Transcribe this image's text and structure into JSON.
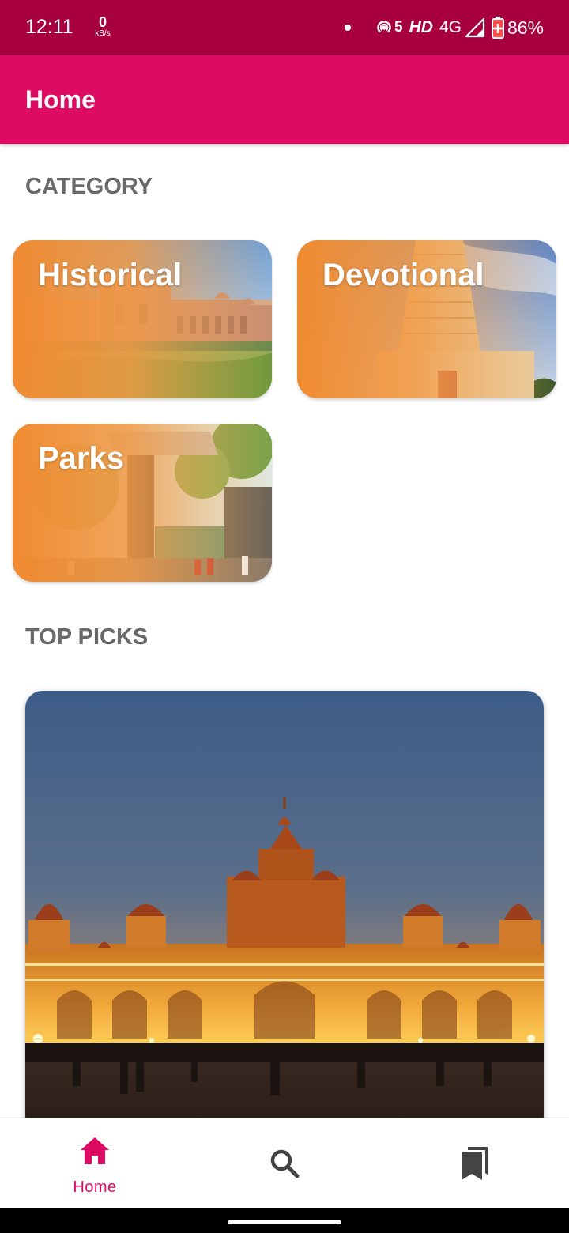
{
  "status_bar": {
    "time": "12:11",
    "net_speed_value": "0",
    "net_speed_unit": "kB/s",
    "hotspot_label": "5",
    "hd_label": "HD",
    "network_label": "4G",
    "battery_percent": "86%",
    "background_color": "#a8003f"
  },
  "app_bar": {
    "title": "Home",
    "color": "#dd0b62"
  },
  "sections": {
    "category_title": "CATEGORY",
    "top_picks_title": "TOP PICKS"
  },
  "categories": [
    {
      "label": "Historical",
      "image": "palace-photo"
    },
    {
      "label": "Devotional",
      "image": "temple-tower-photo"
    },
    {
      "label": "Parks",
      "image": "park-entrance-photo"
    }
  ],
  "top_picks": [
    {
      "image": "illuminated-palace-night-photo"
    }
  ],
  "bottom_nav": {
    "items": [
      {
        "label": "Home",
        "icon": "home-icon",
        "selected": true
      },
      {
        "label": "",
        "icon": "search-icon",
        "selected": false
      },
      {
        "label": "",
        "icon": "bookmarks-icon",
        "selected": false
      }
    ],
    "active_color": "#dd0b62",
    "inactive_color": "#444444"
  }
}
